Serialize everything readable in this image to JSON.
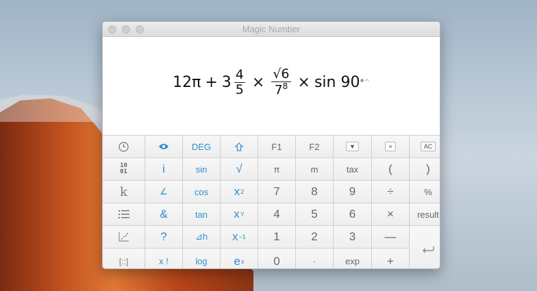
{
  "window": {
    "title": "Magic Number"
  },
  "expression": {
    "a": "12π",
    "plus": "+",
    "whole": "3",
    "num1": "4",
    "den1": "5",
    "times1": "×",
    "num2": "√6",
    "den2": "7",
    "den2_exp": "8",
    "times2": "×",
    "func": "sin 90",
    "deg": "°",
    "caret": "^"
  },
  "keys": {
    "r0": [
      "DEG",
      "F1",
      "F2",
      "▼",
      "×",
      "AC"
    ],
    "r1": [
      "10\n01",
      "i",
      "sin",
      "√",
      "π",
      "m",
      "tax",
      "(",
      ")"
    ],
    "r2": [
      "k",
      "∠",
      "cos",
      "x",
      "2",
      "7",
      "8",
      "9",
      "÷",
      "%"
    ],
    "r3": [
      "&",
      "tan",
      "x",
      "Y",
      "4",
      "5",
      "6",
      "×",
      "result"
    ],
    "r4": [
      "?",
      "⊿h",
      "x",
      "−1",
      "1",
      "2",
      "3",
      "—"
    ],
    "r5": [
      "[::]",
      "x !",
      "log",
      "e",
      "x",
      "0",
      "·",
      "exp",
      "+"
    ]
  },
  "colors": {
    "accent": "#2e8fc8"
  }
}
